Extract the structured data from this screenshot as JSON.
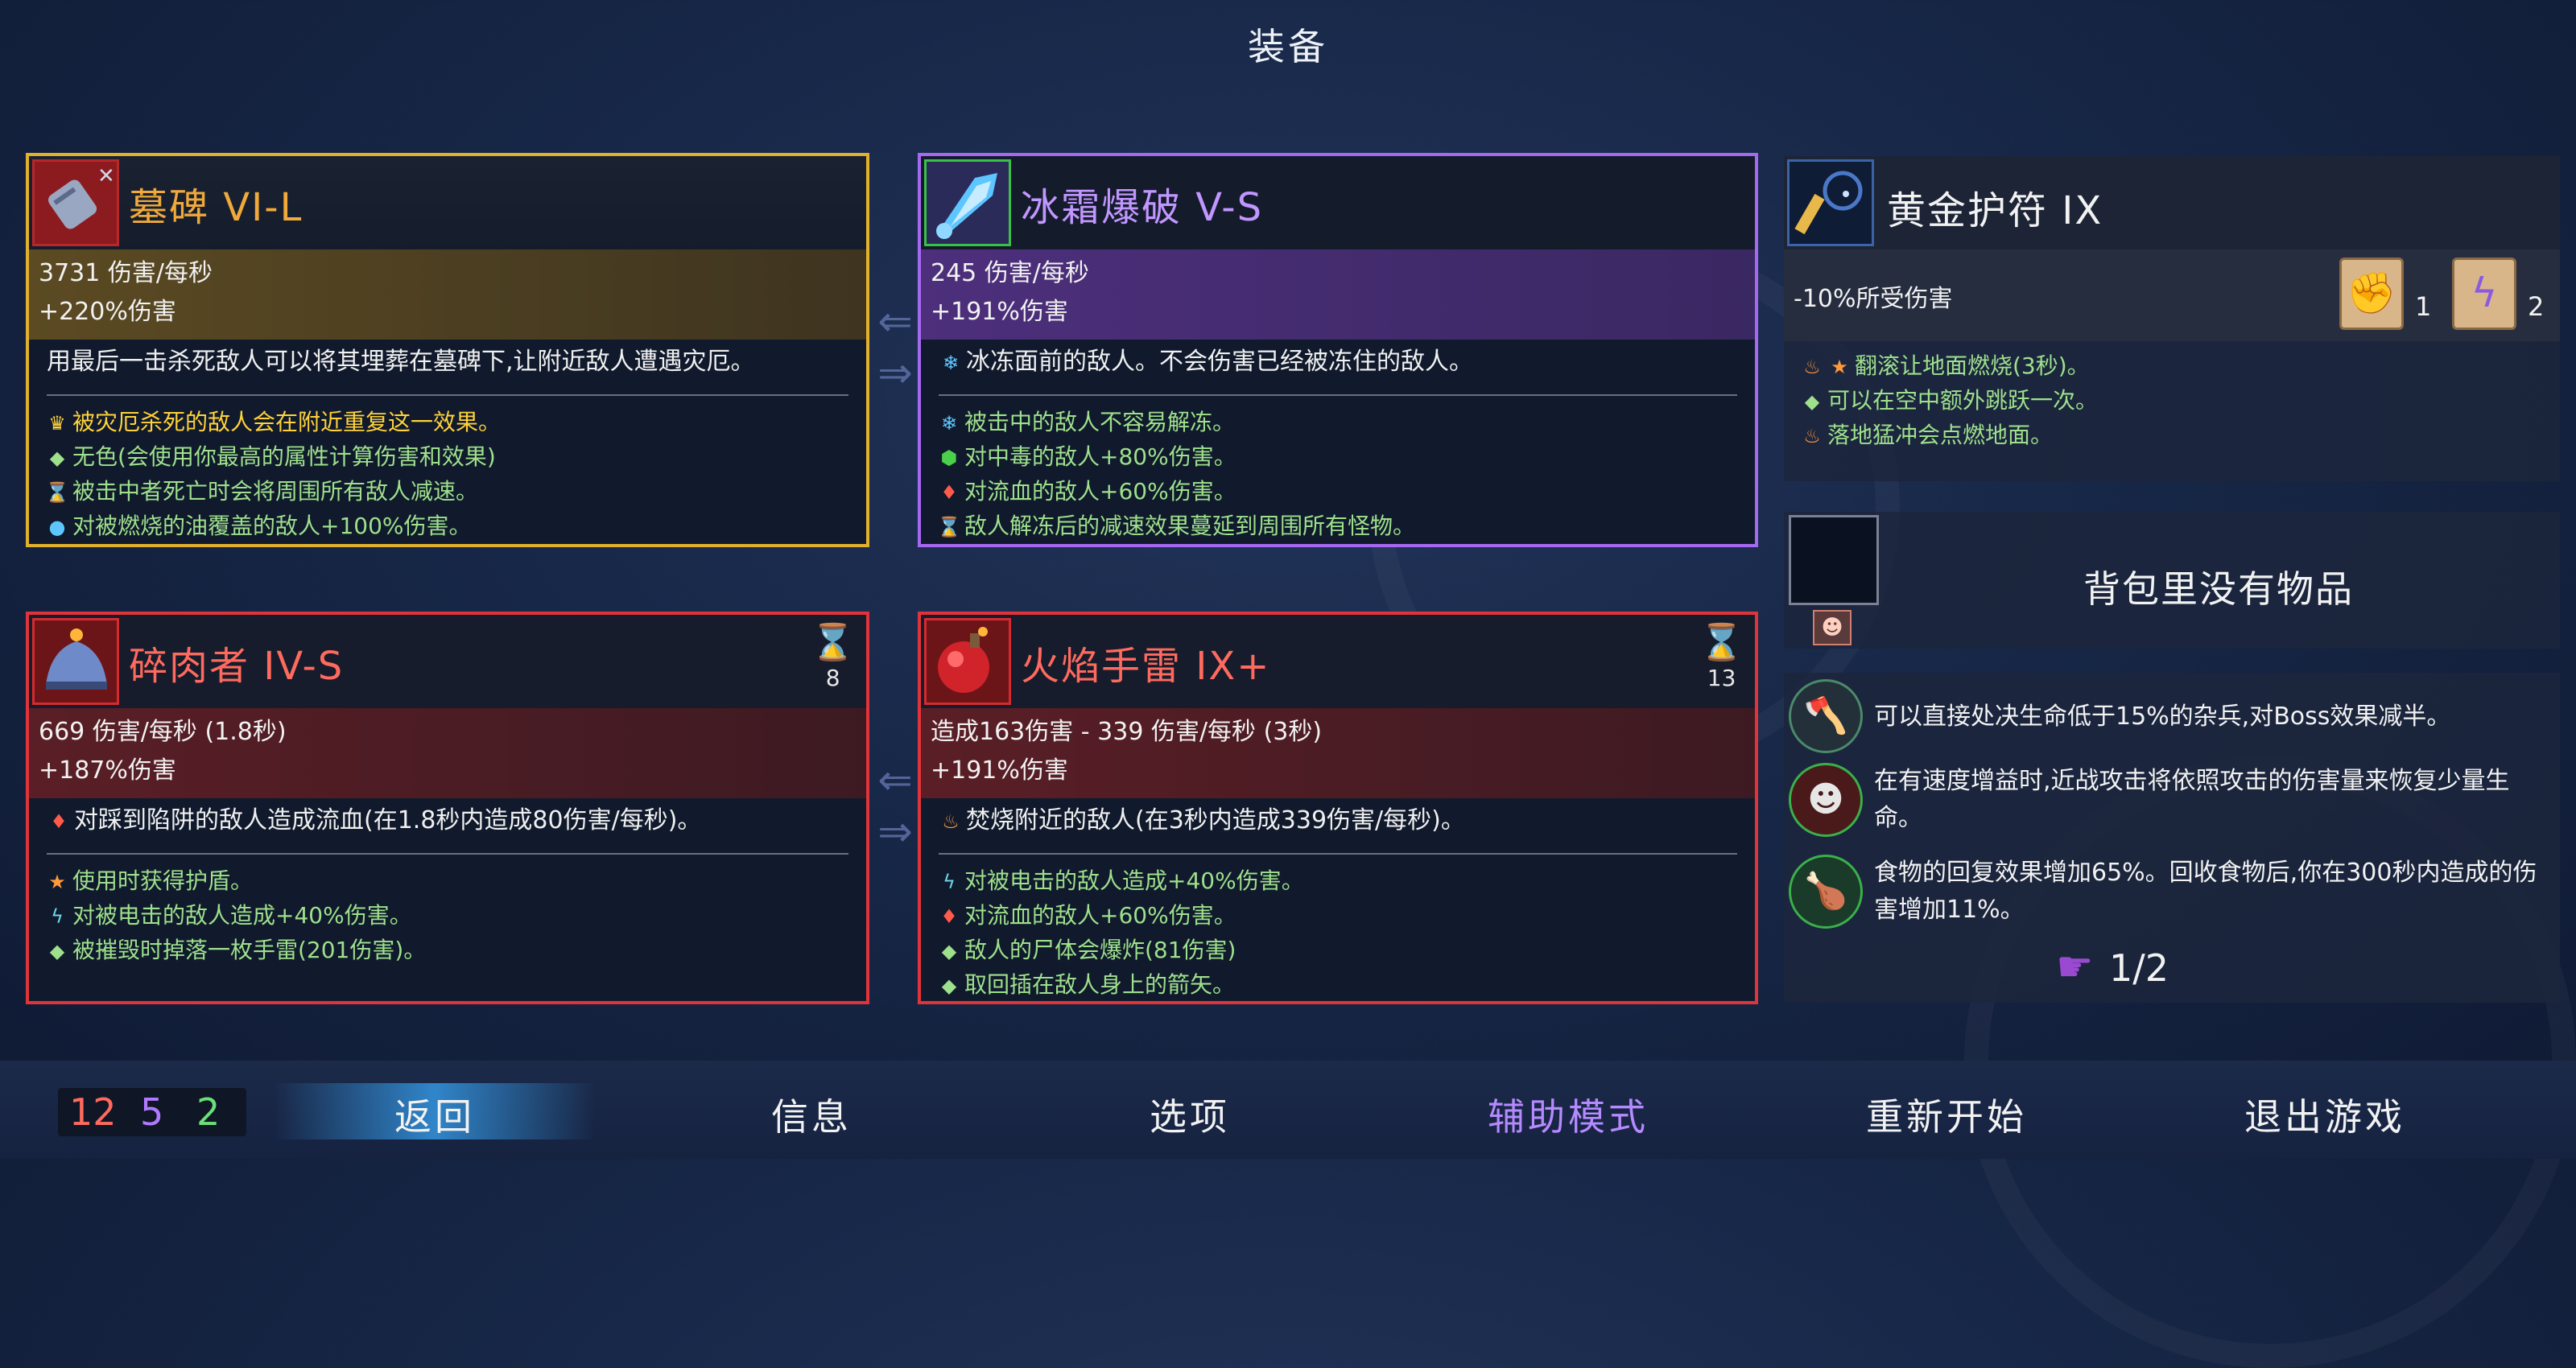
{
  "title": "装备",
  "weapons": [
    {
      "name": "墓碑 VI-L",
      "icon": "tombstone-icon",
      "stats": [
        "3731 伤害/每秒",
        "+220%伤害"
      ],
      "desc": "用最后一击杀死敌人可以将其埋葬在墓碑下,让附近敌人遭遇灾厄。",
      "affixes": [
        {
          "icon": "crown-icon",
          "text": "被灾厄杀死的敌人会在附近重复这一效果。",
          "color": "#ffd23a"
        },
        {
          "icon": "diamond-icon",
          "text": "无色(会使用你最高的属性计算伤害和效果)",
          "color": "#9ee08c"
        },
        {
          "icon": "hourglass-icon",
          "text": "被击中者死亡时会将周围所有敌人减速。",
          "color": "#9ee08c"
        },
        {
          "icon": "orb-icon",
          "text": "对被燃烧的油覆盖的敌人+100%伤害。",
          "color": "#9ee08c"
        }
      ]
    },
    {
      "name": "冰霜爆破 V-S",
      "icon": "frost-blast-icon",
      "stats": [
        "245 伤害/每秒",
        "+191%伤害"
      ],
      "desc": "冰冻面前的敌人。不会伤害已经被冻住的敌人。",
      "affixes": [
        {
          "icon": "snowflake-icon",
          "text": "被击中的敌人不容易解冻。",
          "color": "#9ee08c"
        },
        {
          "icon": "poison-icon",
          "text": "对中毒的敌人+80%伤害。",
          "color": "#9ee08c"
        },
        {
          "icon": "blood-icon",
          "text": "对流血的敌人+60%伤害。",
          "color": "#9ee08c"
        },
        {
          "icon": "hourglass-icon",
          "text": "敌人解冻后的减速效果蔓延到周围所有怪物。",
          "color": "#9ee08c"
        }
      ]
    },
    {
      "name": "碎肉者 IV-S",
      "icon": "meat-grinder-icon",
      "cooldown": "8",
      "stats": [
        "669 伤害/每秒 (1.8秒)",
        "+187%伤害"
      ],
      "desc": "对踩到陷阱的敌人造成流血(在1.8秒内造成80伤害/每秒)。",
      "affixes": [
        {
          "icon": "star-icon",
          "text": "使用时获得护盾。",
          "color": "#9ee08c"
        },
        {
          "icon": "lightning-icon",
          "text": "对被电击的敌人造成+40%伤害。",
          "color": "#9ee08c"
        },
        {
          "icon": "diamond-icon",
          "text": "被摧毁时掉落一枚手雷(201伤害)。",
          "color": "#9ee08c"
        }
      ]
    },
    {
      "name": "火焰手雷 IX+",
      "icon": "fire-grenade-icon",
      "cooldown": "13",
      "stats": [
        "造成163伤害 - 339 伤害/每秒 (3秒)",
        "+191%伤害"
      ],
      "desc": "焚烧附近的敌人(在3秒内造成339伤害/每秒)。",
      "affixes": [
        {
          "icon": "lightning-icon",
          "text": "对被电击的敌人造成+40%伤害。",
          "color": "#9ee08c"
        },
        {
          "icon": "blood-icon",
          "text": "对流血的敌人+60%伤害。",
          "color": "#9ee08c"
        },
        {
          "icon": "diamond-icon",
          "text": "敌人的尸体会爆炸(81伤害)",
          "color": "#9ee08c"
        },
        {
          "icon": "diamond-icon",
          "text": "取回插在敌人身上的箭矢。",
          "color": "#9ee08c"
        }
      ]
    }
  ],
  "amulet": {
    "name": "黄金护符 IX",
    "stat": "-10%所受伤害",
    "scrolls": [
      {
        "icon": "fist-scroll-icon",
        "count": "1"
      },
      {
        "icon": "lightning-scroll-icon",
        "count": "2"
      }
    ],
    "affixes": [
      "翻滚让地面燃烧(3秒)。",
      "可以在空中额外跳跃一次。",
      "落地猛冲会点燃地面。"
    ]
  },
  "backpack": {
    "empty_text": "背包里没有物品"
  },
  "mutations": {
    "items": [
      {
        "icon": "axe-mutation-icon",
        "text": "可以直接处决生命低于15%的杂兵,对Boss效果减半。"
      },
      {
        "icon": "heal-mutation-icon",
        "text": "在有速度增益时,近战攻击将依照攻击的伤害量来恢复少量生命。"
      },
      {
        "icon": "food-mutation-icon",
        "text": "食物的回复效果增加65%。回收食物后,你在300秒内造成的伤害增加11%。"
      }
    ],
    "count": "1/2"
  },
  "counters": {
    "brutality": "12",
    "tactics": "5",
    "survival": "2"
  },
  "menu": [
    "返回",
    "信息",
    "选项",
    "辅助模式",
    "重新开始",
    "退出游戏"
  ]
}
